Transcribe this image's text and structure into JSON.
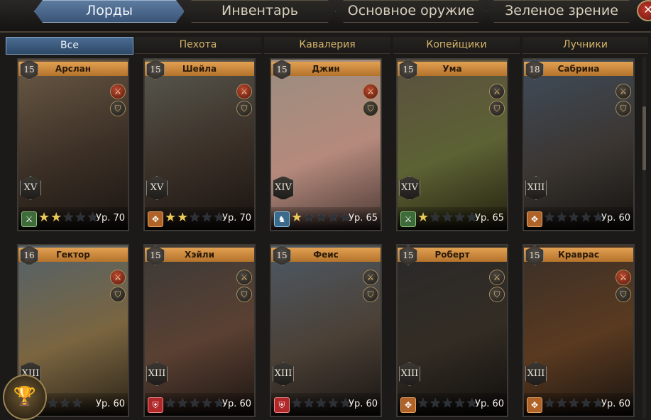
{
  "tabs": [
    "Лорды",
    "Инвентарь",
    "Основное оружие",
    "Зеленое зрение"
  ],
  "close_label": "✕",
  "filters": [
    "Все",
    "Пехота",
    "Кавалерия",
    "Копейщики",
    "Лучники"
  ],
  "lords": [
    {
      "name": "Арслан",
      "badge": "15",
      "rank": "XV",
      "level_text": "Ур. 70",
      "stars": 2,
      "class_icon": "green-sword-icon",
      "class_color": "green",
      "skill1_red": true
    },
    {
      "name": "Шейла",
      "badge": "15",
      "rank": "XV",
      "level_text": "Ур. 70",
      "stars": 2,
      "class_icon": "orange-shield-icon",
      "class_color": "orange",
      "skill1_red": true
    },
    {
      "name": "Джин",
      "badge": "15",
      "rank": "XIV",
      "level_text": "Ур. 65",
      "stars": 1,
      "class_icon": "blue-horse-icon",
      "class_color": "blue",
      "skill1_red": true
    },
    {
      "name": "Ума",
      "badge": "15",
      "rank": "XIV",
      "level_text": "Ур. 65",
      "stars": 1,
      "class_icon": "green-sword-icon",
      "class_color": "green",
      "skill1_red": false
    },
    {
      "name": "Сабрина",
      "badge": "18",
      "rank": "XIII",
      "level_text": "Ур. 60",
      "stars": 0,
      "class_icon": "orange-shield-icon",
      "class_color": "orange",
      "skill1_red": false
    },
    {
      "name": "Гектор",
      "badge": "16",
      "rank": "XIII",
      "level_text": "Ур. 60",
      "stars": 0,
      "class_icon": "none",
      "class_color": "none",
      "skill1_red": true
    },
    {
      "name": "Хэйли",
      "badge": "15",
      "rank": "XIII",
      "level_text": "Ур. 60",
      "stars": 0,
      "class_icon": "red-shield-icon",
      "class_color": "red",
      "skill1_red": false
    },
    {
      "name": "Феис",
      "badge": "15",
      "rank": "XIII",
      "level_text": "Ур. 60",
      "stars": 0,
      "class_icon": "red-shield-icon",
      "class_color": "red",
      "skill1_red": false
    },
    {
      "name": "Роберт",
      "badge": "15",
      "rank": "XIII",
      "level_text": "Ур. 60",
      "stars": 0,
      "class_icon": "orange-shield-icon",
      "class_color": "orange",
      "skill1_red": false
    },
    {
      "name": "Краврас",
      "badge": "15",
      "rank": "XIII",
      "level_text": "Ур. 60",
      "stars": 0,
      "class_icon": "orange-shield-icon",
      "class_color": "orange",
      "skill1_red": true
    }
  ],
  "colors": {
    "accent_tab": "#4a6c92",
    "name_bar": "#d08c40",
    "star_on": "#e9c85a"
  }
}
